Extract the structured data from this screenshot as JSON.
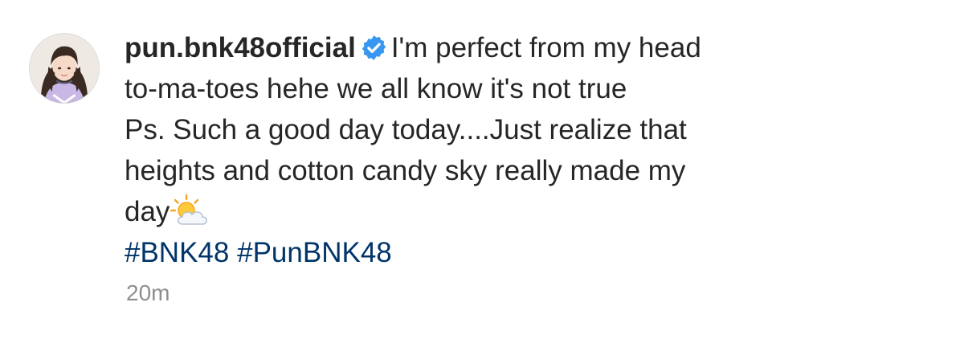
{
  "post": {
    "username": "pun.bnk48official",
    "verified_icon": "verified-badge-icon",
    "caption_line_1": "I'm perfect from my head",
    "caption_line_2": "to-ma-toes hehe we all know it's not true",
    "caption_line_3": "Ps. Such a good day today....Just realize that",
    "caption_line_4": "heights and cotton candy sky really made my",
    "caption_line_5": "day",
    "emoji_icon": "sun-behind-cloud-emoji",
    "hashtags": [
      "#BNK48",
      "#PunBNK48"
    ],
    "timestamp": "20m"
  },
  "colors": {
    "text": "#262626",
    "hashtag": "#003569",
    "verified_badge": "#3897f0",
    "timestamp": "#8e8e8e"
  }
}
